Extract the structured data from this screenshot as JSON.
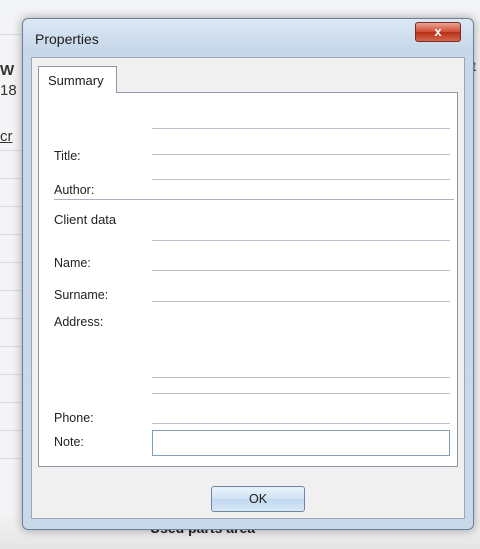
{
  "window": {
    "title": "Properties",
    "close_glyph": "x"
  },
  "tabs": [
    {
      "label": "Summary"
    }
  ],
  "fields": {
    "title_label": "Title:",
    "author_label": "Author:",
    "client_section": "Client data",
    "name_label": "Name:",
    "surname_label": "Surname:",
    "address_label": "Address:",
    "phone_label": "Phone:",
    "note_label": "Note:"
  },
  "buttons": {
    "ok": "OK"
  },
  "background": {
    "left_fragments": [
      "W",
      "18",
      "cr"
    ],
    "right_fragment": "t",
    "bottom_text": "Used parts area"
  }
}
